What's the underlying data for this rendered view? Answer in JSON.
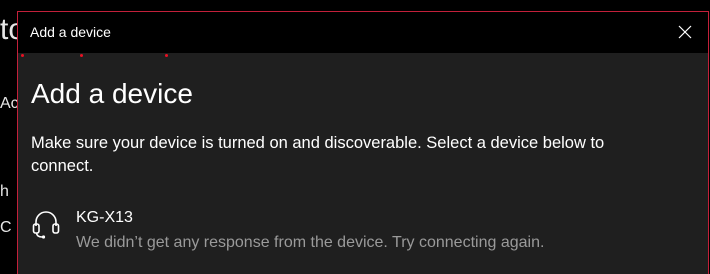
{
  "background_window": {
    "title_fragment": "to",
    "line1_fragment": "Ac",
    "line2_fragment": "h",
    "line3_fragment": "C"
  },
  "dialog": {
    "title_bar": "Add a device",
    "close_icon": "close-icon",
    "heading": "Add a device",
    "description": "Make sure your device is turned on and discoverable. Select a device below to connect.",
    "progress_indicator": "scanning-dots",
    "devices": [
      {
        "icon": "headset-icon",
        "name": "KG-X13",
        "status": "We didn’t get any response from the device. Try connecting again."
      }
    ]
  },
  "colors": {
    "dialog_border": "#c3203a",
    "dialog_background": "#1f1f1f",
    "title_bar_background": "#000000",
    "progress_dots": "#e81123",
    "secondary_text": "#9a9a9a"
  }
}
